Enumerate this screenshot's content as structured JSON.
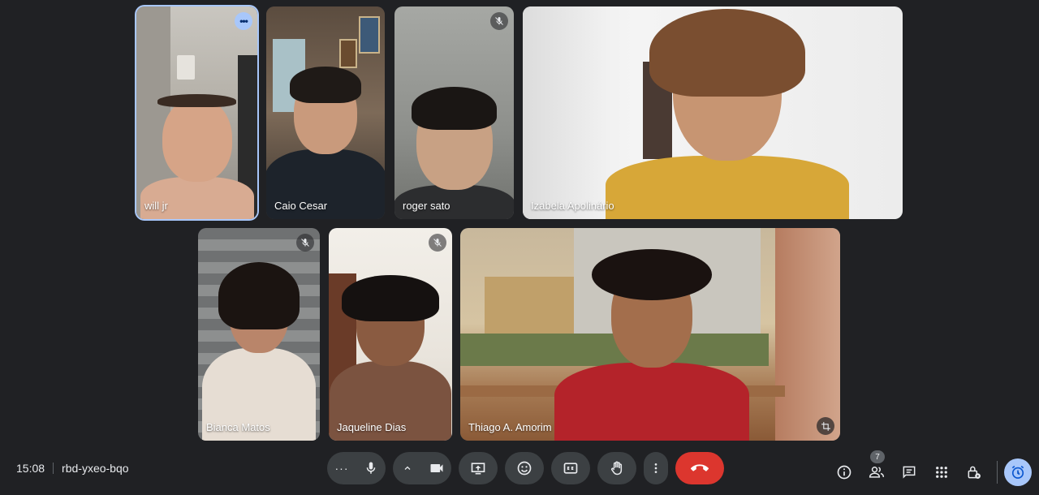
{
  "meeting": {
    "time": "15:08",
    "code": "rbd-yxeo-bqo"
  },
  "participants": [
    {
      "name": "will jr",
      "muted": false,
      "speaking": true
    },
    {
      "name": "Caio Cesar",
      "muted": false,
      "speaking": false
    },
    {
      "name": "roger sato",
      "muted": true,
      "speaking": false
    },
    {
      "name": "Izabela Apolinário",
      "muted": false,
      "speaking": false
    },
    {
      "name": "Bianca Matos",
      "muted": true,
      "speaking": false
    },
    {
      "name": "Jaqueline Dias",
      "muted": true,
      "speaking": false
    },
    {
      "name": "Thiago A. Amorim",
      "muted": false,
      "speaking": false
    }
  ],
  "toolbar": {
    "icons": [
      "more-options-icon",
      "microphone-icon",
      "chevron-up-icon",
      "camera-icon",
      "present-screen-icon",
      "emoji-reaction-icon",
      "captions-icon",
      "raise-hand-icon",
      "more-vert-icon",
      "end-call-icon"
    ],
    "end_call_color": "#dc362e"
  },
  "side_panel": {
    "icons": [
      "info-icon",
      "people-icon",
      "chat-icon",
      "activities-icon",
      "host-controls-icon",
      "timer-icon"
    ],
    "people_count": "7"
  },
  "colors": {
    "background": "#202124",
    "accent": "#a8c7fa"
  }
}
